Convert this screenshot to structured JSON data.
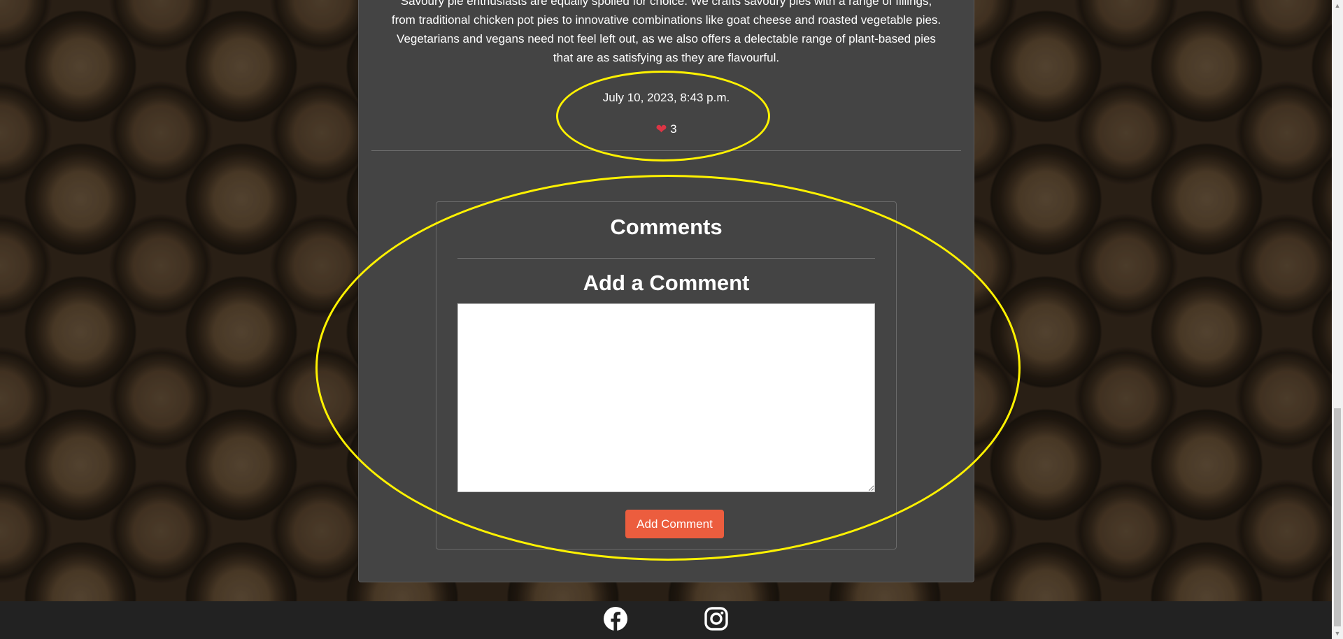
{
  "post": {
    "lines": [
      "Savoury pie enthusiasts are equally spoiled for choice. We crafts savoury pies with a range of fillings,",
      "from traditional chicken pot pies to innovative combinations like goat cheese and roasted vegetable pies.",
      "Vegetarians and vegans need not feel left out, as we also offers a delectable range of plant-based pies",
      "that are as satisfying as they are flavourful."
    ],
    "date": "July 10, 2023, 8:43 p.m.",
    "like_count": "3",
    "like_icon": "heart-icon"
  },
  "comments": {
    "title": "Comments",
    "add_title": "Add a Comment",
    "textarea_value": "",
    "button_label": "Add Comment"
  },
  "footer": {
    "icons": [
      "facebook-icon",
      "instagram-icon"
    ]
  },
  "colors": {
    "card_bg": "#444444",
    "accent_button": "#ec5d3e",
    "heart": "#dc3545",
    "highlight": "#fff200",
    "footer_bg": "#222222"
  }
}
